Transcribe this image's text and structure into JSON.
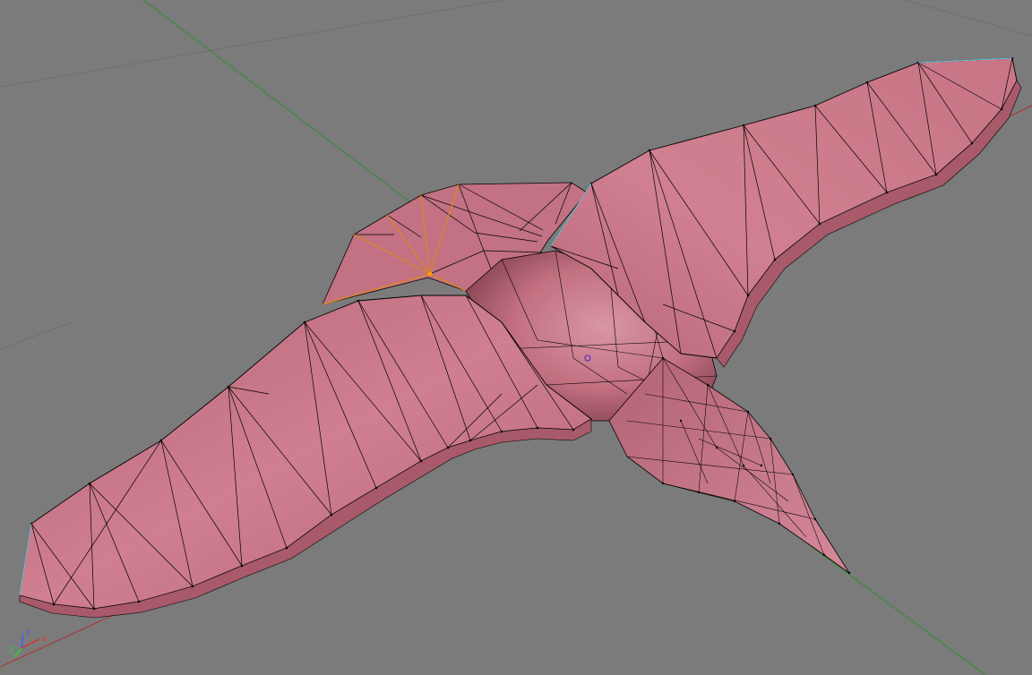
{
  "viewport": {
    "background_color": "#7b7b7b",
    "mode": "perspective",
    "grid_axes": {
      "x_axis_color": "#b03030",
      "y_axis_color": "#2f8f2f",
      "grid_line_color": "#6e6e6e"
    }
  },
  "model": {
    "object": "bird-mesh",
    "shading": "smooth",
    "surface_color": "#c97a8a",
    "wire_color": "#000000",
    "selected_vertex_color": "#ff9a00",
    "selection_edge_color": "#e08a20",
    "boundary_edge_color": "#70c8e0",
    "pivot_marker_color": "#4a20c8"
  },
  "axis_gizmo": {
    "x_label": "x",
    "y_label": "y",
    "z_label": "z",
    "x_color": "#e03030",
    "y_color": "#30d030",
    "z_color": "#4060ff"
  }
}
